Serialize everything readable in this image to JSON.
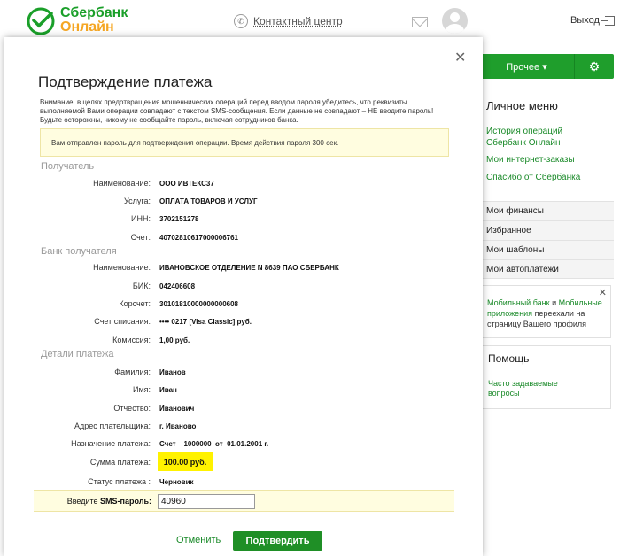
{
  "header": {
    "brand_line1": "Сбербанк",
    "brand_line2": "Онлайн",
    "contact_center": "Контактный центр",
    "logout": "Выход"
  },
  "sidebar": {
    "other_button": "Прочее ▾",
    "personal_menu_title": "Личное меню",
    "links": [
      "История операций Сбербанк Онлайн",
      "Мои интернет-заказы",
      "Спасибо от Сбербанка"
    ],
    "sections": [
      "Мои финансы",
      "Избранное",
      "Мои шаблоны",
      "Мои автоплатежи"
    ],
    "promo": {
      "link1": "Мобильный банк",
      "text1": " и ",
      "link2": "Мобильные приложения",
      "text2": " переехали на страницу Вашего профиля"
    },
    "help": {
      "title": "Помощь",
      "faq": "Часто задаваемые вопросы"
    }
  },
  "modal": {
    "title": "Подтверждение платежа",
    "warning": "Внимание: в целях предотвращения мошеннических операций перед вводом пароля убедитесь, что реквизиты выполняемой Вами операции совпадают с текстом SMS-сообщения. Если данные не совпадают – НЕ вводите пароль! Будьте осторожны, никому не сообщайте пароль, включая сотрудников банка.",
    "notice": "Вам отправлен пароль для подтверждения операции. Время действия пароля 300 сек.",
    "recipient": {
      "title": "Получатель",
      "rows": [
        {
          "label": "Наименование:",
          "value": "ООО ИВТЕКС37"
        },
        {
          "label": "Услуга:",
          "value": "ОПЛАТА ТОВАРОВ И УСЛУГ"
        },
        {
          "label": "ИНН:",
          "value": "3702151278"
        },
        {
          "label": "Счет:",
          "value": "40702810617000006761"
        }
      ]
    },
    "bank": {
      "title": "Банк получателя",
      "rows": [
        {
          "label": "Наименование:",
          "value": "ИВАНОВСКОЕ ОТДЕЛЕНИЕ N 8639 ПАО СБЕРБАНК"
        },
        {
          "label": "БИК:",
          "value": "042406608"
        },
        {
          "label": "Корсчет:",
          "value": "30101810000000000608"
        },
        {
          "label": "Счет списания:",
          "value": "•••• 0217  [Visa Classic]  руб."
        },
        {
          "label": "Комиссия:",
          "value": "1,00 руб."
        }
      ]
    },
    "details": {
      "title": "Детали платежа",
      "rows": [
        {
          "label": "Фамилия:",
          "value": "Иванов"
        },
        {
          "label": "Имя:",
          "value": "Иван"
        },
        {
          "label": "Отчество:",
          "value": "Иванович"
        },
        {
          "label": "Адрес плательщика:",
          "value": "г. Иваново"
        },
        {
          "label": "Назначение платежа:",
          "value": "Счет    1000000  от  01.01.2001 г."
        },
        {
          "label": "Сумма платежа:",
          "value": "100.00 руб."
        },
        {
          "label": "Статус платежа :",
          "value": "Черновик"
        }
      ]
    },
    "sms": {
      "label_prefix": "Введите ",
      "label_bold": "SMS-пароль:",
      "value": "40960"
    },
    "cancel": "Отменить",
    "confirm": "Подтвердить"
  }
}
